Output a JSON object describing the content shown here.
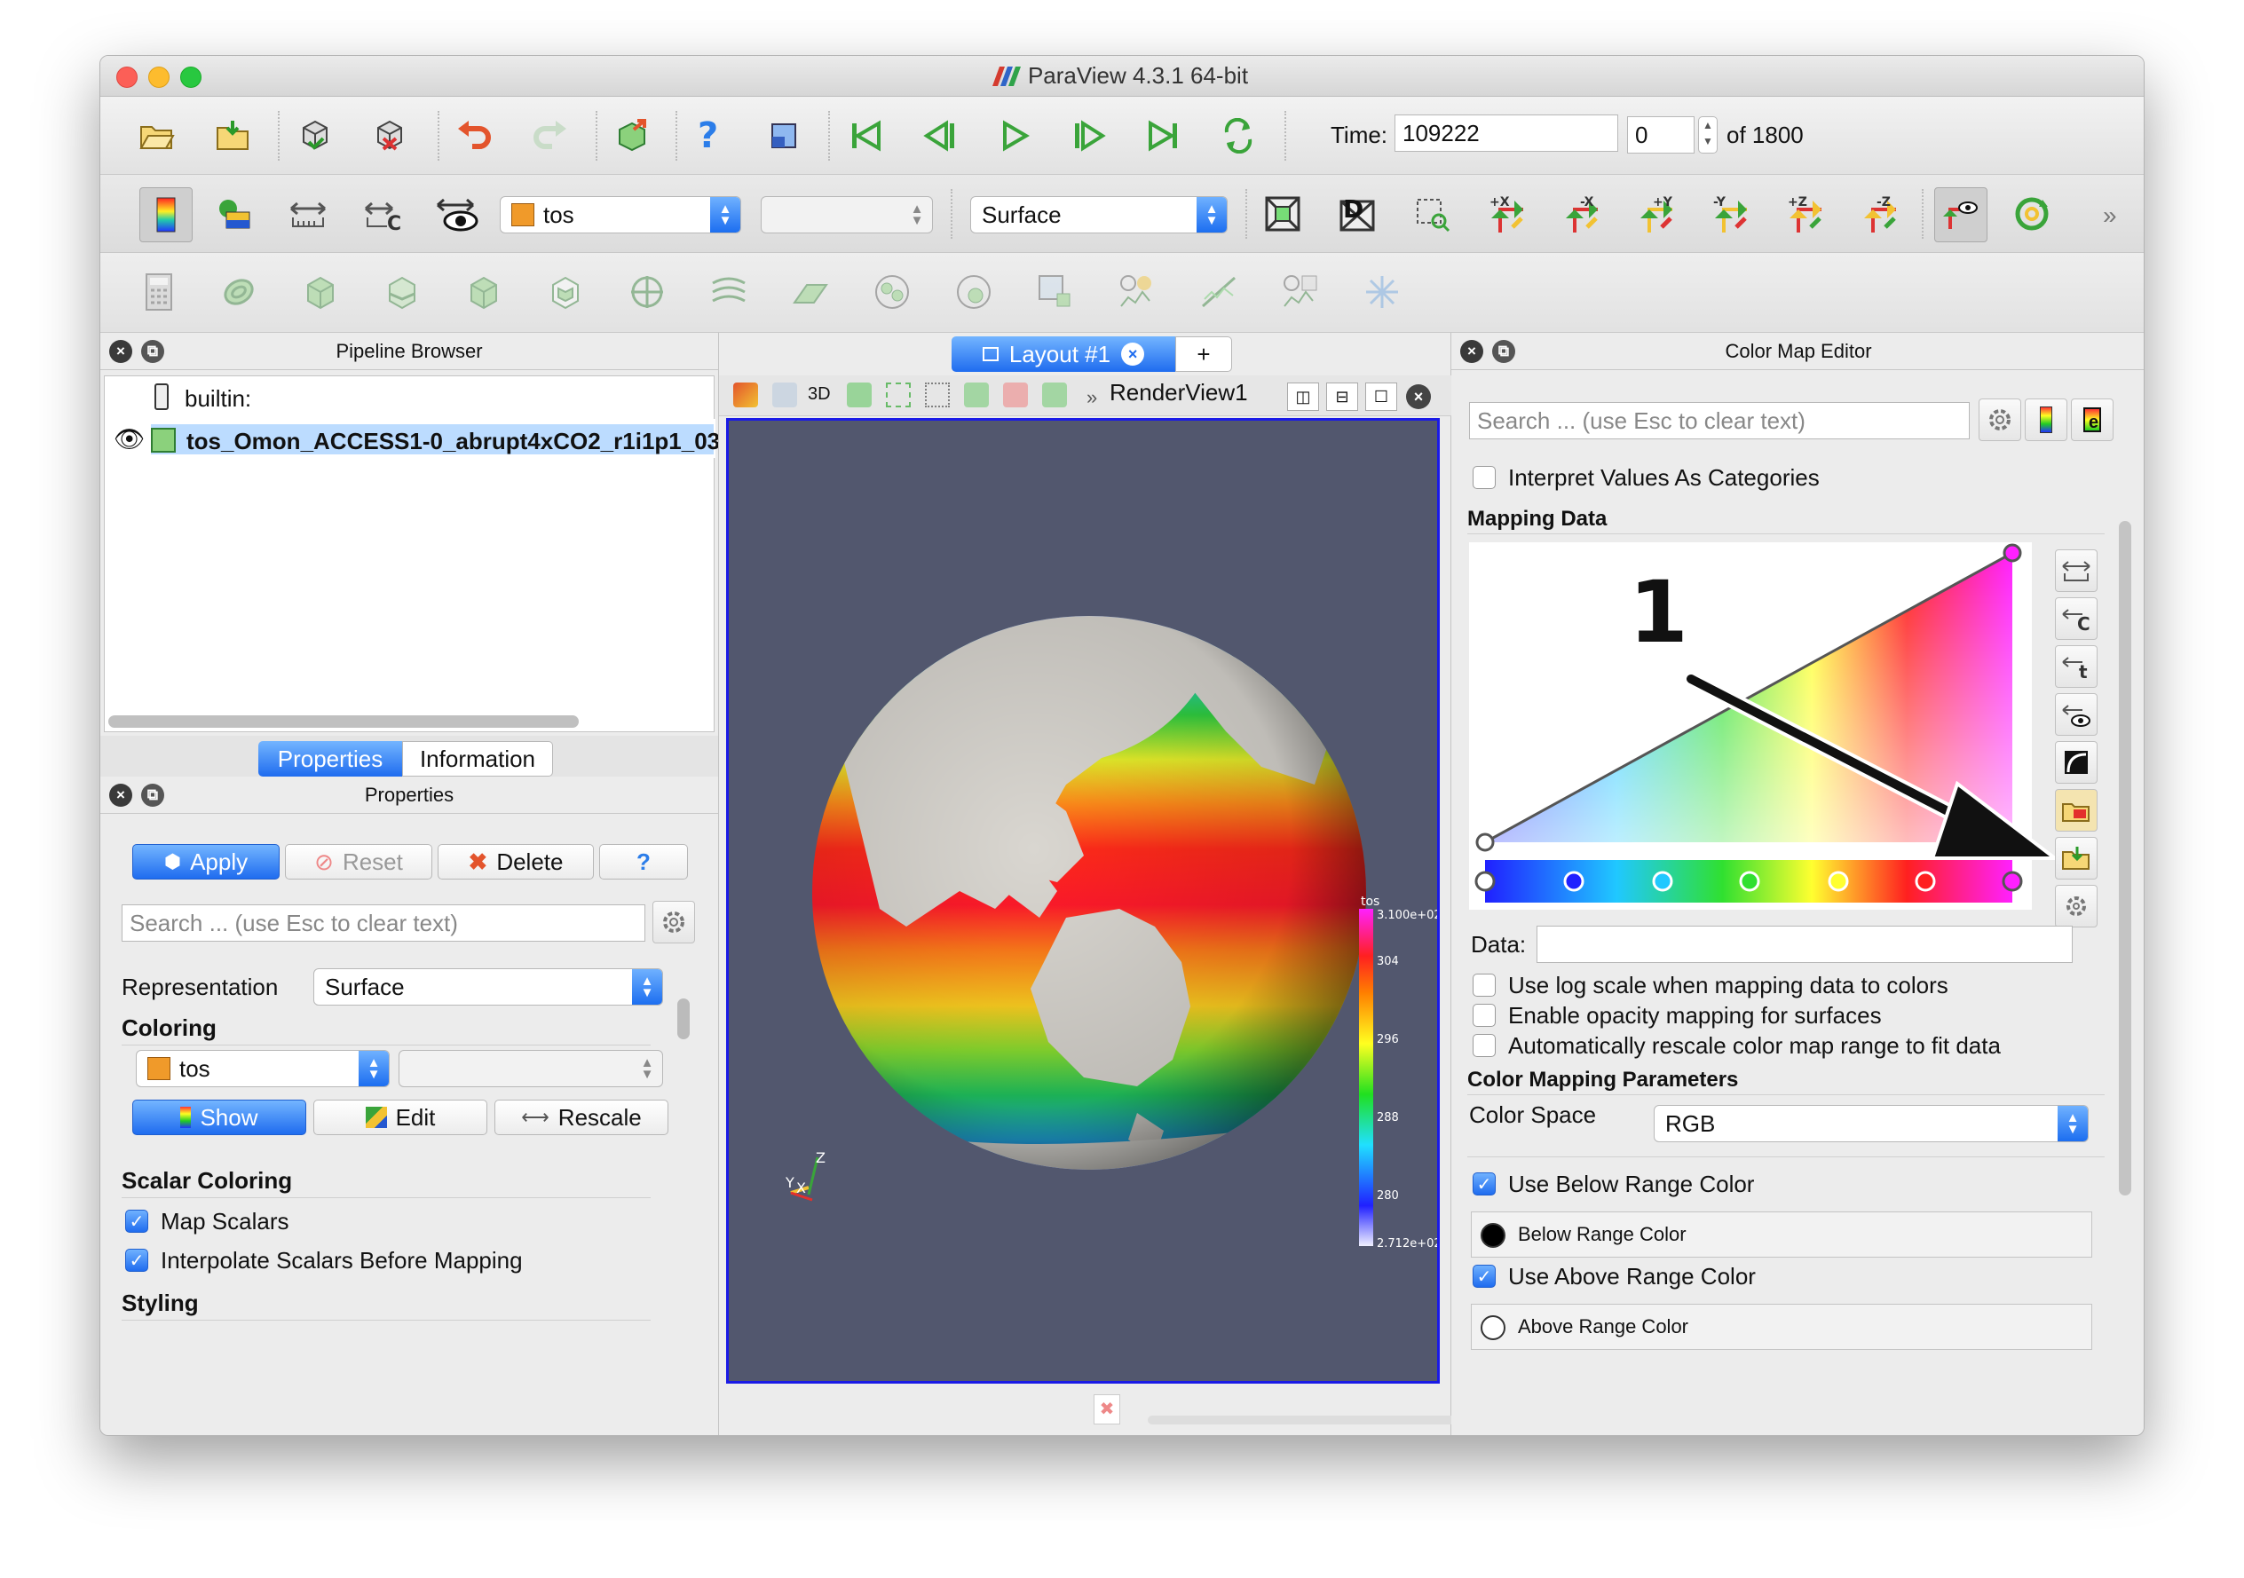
{
  "window": {
    "title": "ParaView 4.3.1 64-bit",
    "logo_colors": [
      "#d43b2f",
      "#3065c8",
      "#2fa34a"
    ]
  },
  "toolbar": {
    "time_label": "Time:",
    "time_value": "109222",
    "timestep_value": "0",
    "timestep_total": "of 1800",
    "array_select": "tos",
    "component_select": "",
    "representation_select": "Surface"
  },
  "pipeline": {
    "title": "Pipeline Browser",
    "items": [
      {
        "label": "builtin:"
      },
      {
        "label": "tos_Omon_ACCESS1-0_abrupt4xCO2_r1i1p1_03"
      }
    ]
  },
  "tabs": {
    "properties": "Properties",
    "information": "Information"
  },
  "properties": {
    "title": "Properties",
    "apply": "Apply",
    "reset": "Reset",
    "delete": "Delete",
    "help": "?",
    "search_placeholder": "Search ... (use Esc to clear text)",
    "representation_label": "Representation",
    "representation_value": "Surface",
    "coloring_section": "Coloring",
    "coloring_array": "tos",
    "coloring_component": "",
    "show": "Show",
    "edit": "Edit",
    "rescale": "Rescale",
    "scalar_section": "Scalar Coloring",
    "map_scalars": "Map Scalars",
    "interpolate_scalars": "Interpolate Scalars Before Mapping",
    "styling_section": "Styling"
  },
  "layout": {
    "tab_label": "Layout #1",
    "add_tab": "+",
    "view_name": "RenderView1",
    "view_3d": "3D",
    "view_bg": "#52576e",
    "colorbar_title": "tos",
    "colorbar_ticks": [
      "3.100e+02",
      "304",
      "296",
      "288",
      "280",
      "2.712e+02"
    ],
    "axes_labels": [
      "Z",
      "Y",
      "X"
    ]
  },
  "colormap": {
    "title": "Color Map Editor",
    "search_placeholder": "Search ... (use Esc to clear text)",
    "interpret_categories": "Interpret Values As Categories",
    "mapping_section": "Mapping Data",
    "annotation_number": "1",
    "data_label": "Data:",
    "data_value": "",
    "use_log": "Use log scale when mapping data to colors",
    "enable_opacity": "Enable opacity mapping for surfaces",
    "auto_rescale": "Automatically rescale color map range to fit data",
    "params_section": "Color Mapping Parameters",
    "color_space_label": "Color Space",
    "color_space_value": "RGB",
    "use_below": "Use Below Range Color",
    "below_color": "Below Range Color",
    "use_above": "Use Above Range Color",
    "above_color": "Above Range Color"
  }
}
